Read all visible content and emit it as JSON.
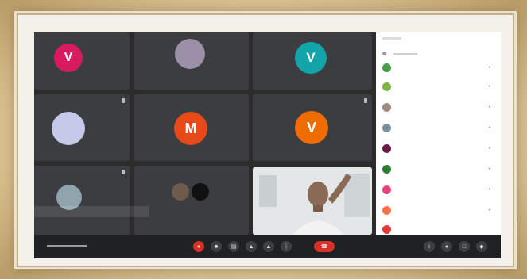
{
  "tiles": [
    {
      "initial": "V",
      "color": "#d81b60",
      "name": "",
      "kind": "letter"
    },
    {
      "initial": "",
      "color": "#9c8fa8",
      "name": "",
      "kind": "photo"
    },
    {
      "initial": "V",
      "color": "#12a4a8",
      "name": "",
      "kind": "letter"
    },
    {
      "initial": "",
      "color": "#c5cae9",
      "name": "",
      "kind": "blank"
    },
    {
      "initial": "M",
      "color": "#e64a19",
      "name": "",
      "kind": "letter"
    },
    {
      "initial": "V",
      "color": "#ef6c00",
      "name": "",
      "kind": "letter"
    },
    {
      "initial": "",
      "color": "#90a4ae",
      "name": "",
      "kind": "blank"
    },
    {
      "initial": "",
      "color": "#6d5b4d",
      "name": "",
      "kind": "pair"
    }
  ],
  "captions": {
    "line1": "",
    "line2": ""
  },
  "panel": {
    "rows": [
      {
        "color": "#43a047"
      },
      {
        "color": "#7cb342"
      },
      {
        "color": "#a1887f"
      },
      {
        "color": "#78909c"
      },
      {
        "color": "#6a1b4d"
      },
      {
        "color": "#2e7d32"
      },
      {
        "color": "#ec407a"
      },
      {
        "color": "#ff7043"
      },
      {
        "color": "#e53935"
      }
    ]
  },
  "controls": {
    "mic_icon": "mic-off-icon",
    "camera_icon": "camera-icon",
    "end_icon": "end-call-icon"
  }
}
